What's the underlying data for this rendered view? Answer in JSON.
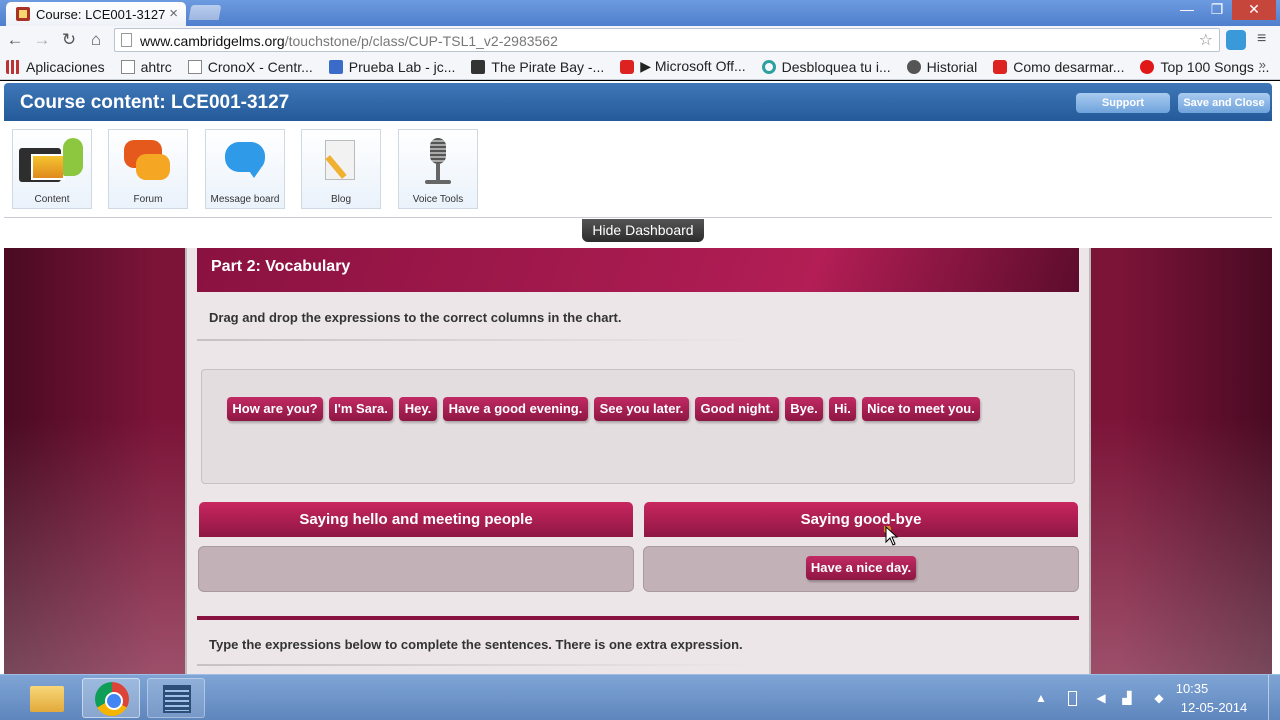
{
  "browser": {
    "tab_title": "Course: LCE001-3127",
    "tab_close": "×",
    "window_controls": [
      "—",
      "❐",
      "✕"
    ],
    "url_host": "www.cambridgelms.org",
    "url_path": "/touchstone/p/class/CUP-TSL1_v2-2983562",
    "bookmarks": [
      {
        "label": "Aplicaciones",
        "icon": "apps-icon"
      },
      {
        "label": "ahtrc",
        "icon": "page-icon"
      },
      {
        "label": "CronoX - Centr...",
        "icon": "doc-icon"
      },
      {
        "label": "Prueba Lab - jc...",
        "icon": "blue-icon"
      },
      {
        "label": "The Pirate Bay -...",
        "icon": "ship-icon"
      },
      {
        "label": "▶ Microsoft Off...",
        "icon": "youtube-icon"
      },
      {
        "label": "Desbloquea tu i...",
        "icon": "chrome-icon"
      },
      {
        "label": "Historial",
        "icon": "history-icon"
      },
      {
        "label": "Como desarmar...",
        "icon": "youtube-icon"
      },
      {
        "label": "Top 100 Songs ...",
        "icon": "red-circle-icon"
      }
    ],
    "bookmarks_overflow": "»"
  },
  "course": {
    "title": "Course content: LCE001-3127",
    "support_label": "Support",
    "save_close_label": "Save and Close"
  },
  "dashboard": {
    "items": [
      {
        "label": "Content",
        "icon": "content-icon"
      },
      {
        "label": "Forum",
        "icon": "forum-icon"
      },
      {
        "label": "Message board",
        "icon": "message-board-icon"
      },
      {
        "label": "Blog",
        "icon": "blog-icon"
      },
      {
        "label": "Voice Tools",
        "icon": "microphone-icon"
      }
    ],
    "hide_label": "Hide Dashboard"
  },
  "lesson": {
    "part_title": "Part 2: Vocabulary",
    "instruction_1": "Drag and drop the expressions to the correct columns in the chart.",
    "word_bank": [
      "How are you?",
      "I'm Sara.",
      "Hey.",
      "Have a good evening.",
      "See you later.",
      "Good night.",
      "Bye.",
      "Hi.",
      "Nice to meet you."
    ],
    "columns": [
      {
        "header": "Saying hello and meeting people",
        "items": []
      },
      {
        "header": "Saying good-bye",
        "items": [
          "Have a nice day."
        ]
      }
    ],
    "instruction_2": "Type the expressions below to complete the sentences. There is one extra expression."
  },
  "taskbar": {
    "apps": [
      "file-explorer-icon",
      "chrome-icon",
      "video-icon"
    ],
    "time": "10:35",
    "date": "12-05-2014"
  },
  "colors": {
    "accent_crimson": "#8e1743",
    "header_blue": "#245a99",
    "taskbar_blue": "#5f86bd"
  }
}
